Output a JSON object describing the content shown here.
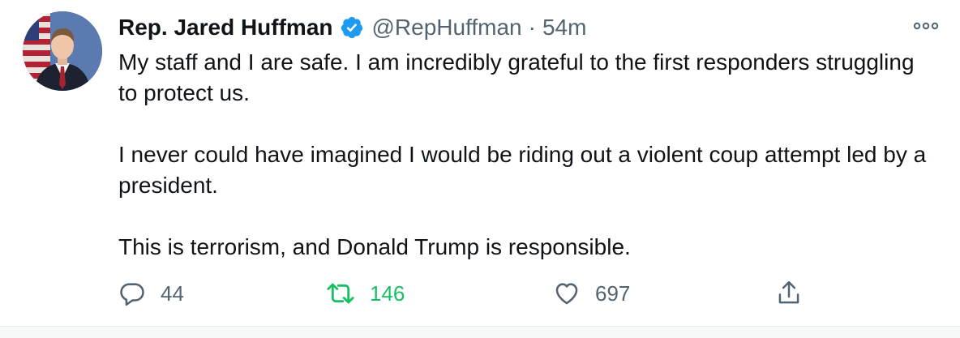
{
  "tweet": {
    "author": {
      "display_name": "Rep. Jared Huffman",
      "handle": "@RepHuffman",
      "verified": true,
      "avatar_icon": "profile-photo"
    },
    "separator": "·",
    "time": "54m",
    "more_icon": "more-horizontal-icon",
    "paragraphs": [
      "My staff and I are safe. I am incredibly grateful to the first responders struggling to protect us.",
      "I never could have imagined I would be riding out a violent coup attempt led by a president.",
      "This is terrorism, and Donald Trump is responsible."
    ],
    "actions": {
      "reply": {
        "count": "44",
        "icon": "reply-icon"
      },
      "retweet": {
        "count": "146",
        "icon": "retweet-icon",
        "active": true
      },
      "like": {
        "count": "697",
        "icon": "heart-icon"
      },
      "share": {
        "icon": "share-icon"
      }
    }
  },
  "colors": {
    "text_primary": "#0f1419",
    "text_secondary": "#536471",
    "verified_blue": "#1d9bf0",
    "retweet_green": "#17bf63"
  }
}
